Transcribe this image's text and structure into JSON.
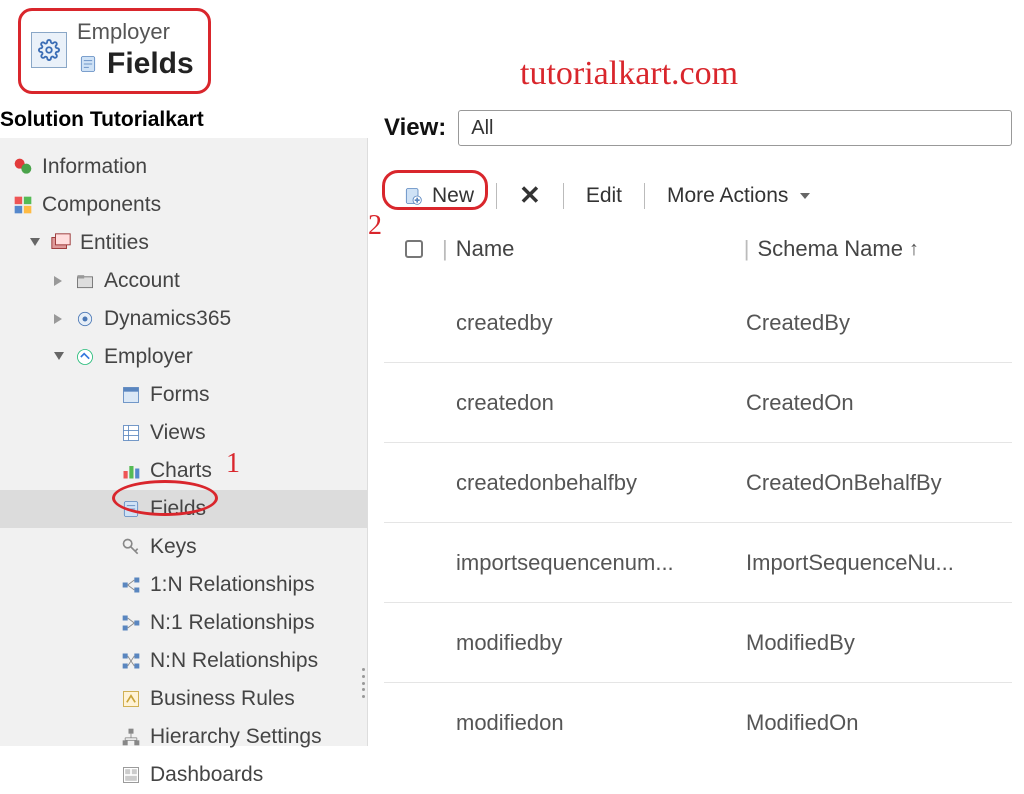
{
  "header": {
    "entity": "Employer",
    "section": "Fields"
  },
  "watermark": "tutorialkart.com",
  "solution_label": "Solution Tutorialkart",
  "tree": {
    "information": "Information",
    "components": "Components",
    "entities": "Entities",
    "account": "Account",
    "dynamics365": "Dynamics365",
    "employer": "Employer",
    "forms": "Forms",
    "views": "Views",
    "charts": "Charts",
    "fields": "Fields",
    "keys": "Keys",
    "rel_1n": "1:N Relationships",
    "rel_n1": "N:1 Relationships",
    "rel_nn": "N:N Relationships",
    "business_rules": "Business Rules",
    "hierarchy": "Hierarchy Settings",
    "dashboards": "Dashboards"
  },
  "annotations": {
    "one": "1",
    "two": "2"
  },
  "view": {
    "label": "View:",
    "value": "All"
  },
  "toolbar": {
    "new_btn": "New",
    "edit_btn": "Edit",
    "more_btn": "More Actions"
  },
  "table": {
    "col_name": "Name",
    "col_schema": "Schema Name",
    "rows": [
      {
        "name": "createdby",
        "schema": "CreatedBy"
      },
      {
        "name": "createdon",
        "schema": "CreatedOn"
      },
      {
        "name": "createdonbehalfby",
        "schema": "CreatedOnBehalfBy"
      },
      {
        "name": "importsequencenum...",
        "schema": "ImportSequenceNu..."
      },
      {
        "name": "modifiedby",
        "schema": "ModifiedBy"
      },
      {
        "name": "modifiedon",
        "schema": "ModifiedOn"
      }
    ]
  }
}
